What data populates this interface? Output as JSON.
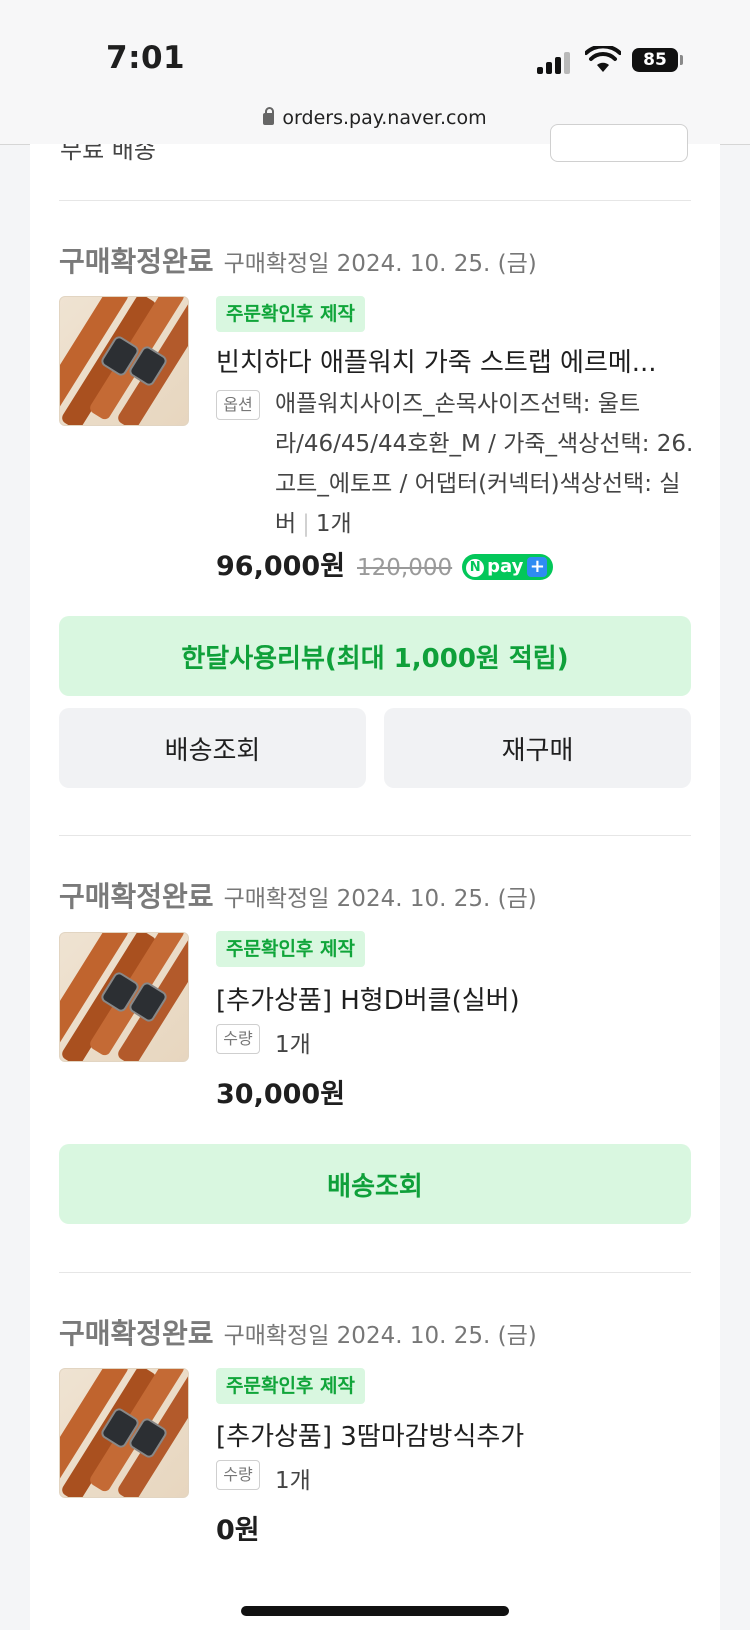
{
  "status_bar": {
    "time": "7:01",
    "battery": "85"
  },
  "url_bar": {
    "domain": "orders.pay.naver.com"
  },
  "partial_top": {
    "text": "무료 배송"
  },
  "orders": [
    {
      "status": "구매확정완료",
      "date": "구매확정일 2024. 10. 25. (금)",
      "badge": "주문확인후 제작",
      "name": "빈치하다 애플워치 가죽 스트랩 에르메...",
      "option_tag": "옵션",
      "option_text": "애플워치사이즈_손목사이즈선택: 울트라/46/45/44호환_M / 가죽_색상선택: 26.고트_에토프 / 어댑터(커넥터)색상선택: 실버",
      "quantity": "1개",
      "price": "96,000원",
      "original_price": "120,000",
      "npay_label": "pay",
      "buttons": {
        "review": "한달사용리뷰(최대 1,000원 적립)",
        "tracking": "배송조회",
        "rebuy": "재구매"
      }
    },
    {
      "status": "구매확정완료",
      "date": "구매확정일 2024. 10. 25. (금)",
      "badge": "주문확인후 제작",
      "name": "[추가상품] H형D버클(실버)",
      "qty_tag": "수량",
      "quantity": "1개",
      "price": "30,000원",
      "buttons": {
        "tracking": "배송조회"
      }
    },
    {
      "status": "구매확정완료",
      "date": "구매확정일 2024. 10. 25. (금)",
      "badge": "주문확인후 제작",
      "name": "[추가상품] 3땀마감방식추가",
      "qty_tag": "수량",
      "quantity": "1개",
      "price": "0원"
    }
  ],
  "colors": {
    "accent_green": "#10a53a",
    "badge_bg": "#d9f7e0",
    "npay_green": "#03c75a"
  }
}
